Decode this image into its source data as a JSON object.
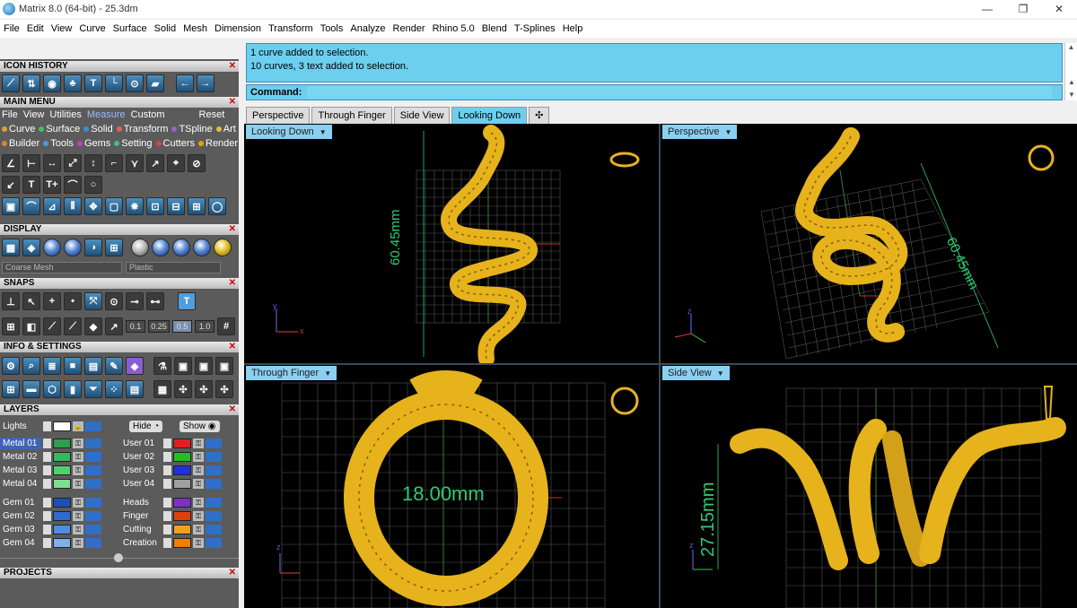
{
  "window": {
    "title": "Matrix 8.0 (64-bit) - 25.3dm",
    "minimize": "—",
    "restore": "❐",
    "close": "✕"
  },
  "menu": [
    "File",
    "Edit",
    "View",
    "Curve",
    "Surface",
    "Solid",
    "Mesh",
    "Dimension",
    "Transform",
    "Tools",
    "Analyze",
    "Render",
    "Rhino 5.0",
    "Blend",
    "T-Splines",
    "Help"
  ],
  "panels": {
    "icon_history": "ICON HISTORY",
    "main_menu": "MAIN MENU",
    "display": "DISPLAY",
    "snaps": "SNAPS",
    "info": "INFO & SETTINGS",
    "layers": "LAYERS",
    "projects": "PROJECTS"
  },
  "main_menu_tabs": [
    "File",
    "View",
    "Utilities",
    "Measure",
    "Custom",
    "Reset"
  ],
  "main_menu_row1": [
    {
      "label": "Curve",
      "color": "#e0a030"
    },
    {
      "label": "Surface",
      "color": "#40c060"
    },
    {
      "label": "Solid",
      "color": "#3a8fd8"
    },
    {
      "label": "Transform",
      "color": "#e06060"
    },
    {
      "label": "TSpline",
      "color": "#a060d0"
    },
    {
      "label": "Art",
      "color": "#e0c040"
    }
  ],
  "main_menu_row2": [
    {
      "label": "Builder",
      "color": "#e08030"
    },
    {
      "label": "Tools",
      "color": "#40a0e0"
    },
    {
      "label": "Gems",
      "color": "#c040c0"
    },
    {
      "label": "Setting",
      "color": "#30c0a0"
    },
    {
      "label": "Cutters",
      "color": "#e04040"
    },
    {
      "label": "Render",
      "color": "#f0a000"
    }
  ],
  "display": {
    "mesh": "Coarse Mesh",
    "material": "Plastic"
  },
  "snaps_values": [
    "0.1",
    "0.25",
    "0.5",
    "1.0"
  ],
  "layers": {
    "lights": "Lights",
    "hide": "Hide",
    "show": "Show",
    "left": [
      {
        "name": "Metal 01",
        "color": "#2f9e4f",
        "selected": true
      },
      {
        "name": "Metal 02",
        "color": "#37b85c",
        "selected": false
      },
      {
        "name": "Metal 03",
        "color": "#4fd070",
        "selected": false
      },
      {
        "name": "Metal 04",
        "color": "#7ee08f",
        "selected": false
      },
      {
        "name": "Gem 01",
        "color": "#1e4fb4",
        "selected": false
      },
      {
        "name": "Gem 02",
        "color": "#2f6ad0",
        "selected": false
      },
      {
        "name": "Gem 03",
        "color": "#4f8de0",
        "selected": false
      },
      {
        "name": "Gem 04",
        "color": "#7fb0ee",
        "selected": false
      }
    ],
    "right": [
      {
        "name": "User 01",
        "color": "#e02020"
      },
      {
        "name": "User 02",
        "color": "#20c020"
      },
      {
        "name": "User 03",
        "color": "#2030e0"
      },
      {
        "name": "User 04",
        "color": "#a0a0a0"
      },
      {
        "name": "Heads",
        "color": "#8030c0"
      },
      {
        "name": "Finger",
        "color": "#e04010"
      },
      {
        "name": "Cutting",
        "color": "#f0a020"
      },
      {
        "name": "Creation",
        "color": "#f08000"
      }
    ]
  },
  "command": {
    "history_line1": "1 curve added to selection.",
    "history_line2": "10 curves, 3 text added to selection.",
    "label": "Command:",
    "value": ""
  },
  "tabs": [
    {
      "label": "Perspective",
      "active": false
    },
    {
      "label": "Through Finger",
      "active": false
    },
    {
      "label": "Side View",
      "active": false
    },
    {
      "label": "Looking Down",
      "active": true
    },
    {
      "label": "✣",
      "active": false
    }
  ],
  "viewports": {
    "top_left": {
      "label": "Looking Down",
      "dim": "60.45mm"
    },
    "top_right": {
      "label": "Perspective",
      "dim": "60.45mm"
    },
    "bottom_left": {
      "label": "Through Finger",
      "dim": "18.00mm"
    },
    "bottom_right": {
      "label": "Side View",
      "dim": "27.15mm"
    }
  },
  "axes": {
    "x": "x",
    "y": "y",
    "z": "z"
  },
  "colors": {
    "gold": "#e6b31c",
    "panel": "#5b5b5b",
    "accent": "#6ccfee",
    "dim": "#2ecc71"
  }
}
